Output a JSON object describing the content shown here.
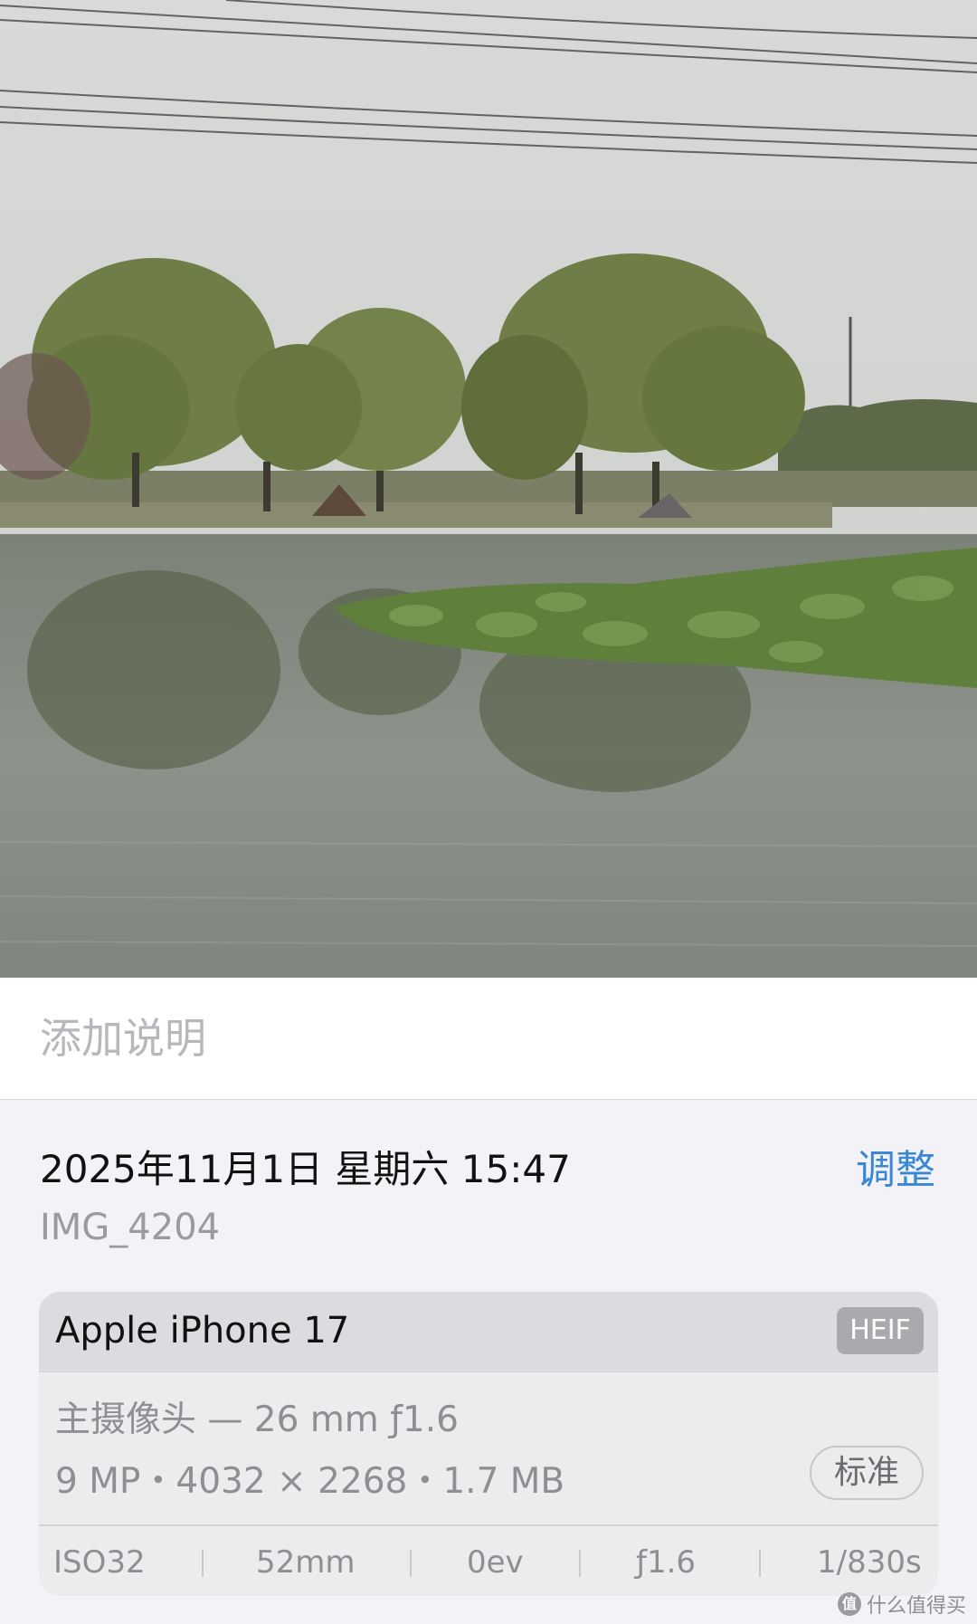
{
  "photo": {
    "description_icon": "landscape-photo",
    "colors": {
      "sky": "#d6d7d6",
      "tree": "#6e7d46",
      "water": "#8a8f87",
      "lotus": "#5f7f3c"
    }
  },
  "caption": {
    "placeholder": "添加说明"
  },
  "info": {
    "datetime": "2025年11月1日 星期六 15:47",
    "adjust_label": "调整",
    "filename": "IMG_4204"
  },
  "camera_card": {
    "device": "Apple iPhone 17",
    "format": "HEIF",
    "lens": "主摄像头 — 26 mm ƒ1.6",
    "specs": "9 MP・4032 × 2268・1.7 MB",
    "quality_label": "标准",
    "exif": {
      "iso": "ISO32",
      "focal": "52mm",
      "ev": "0ev",
      "aperture": "ƒ1.6",
      "shutter": "1/830s"
    }
  },
  "watermark": {
    "logo": "值",
    "text": "什么值得买"
  },
  "accent_color": "#3a87d6"
}
